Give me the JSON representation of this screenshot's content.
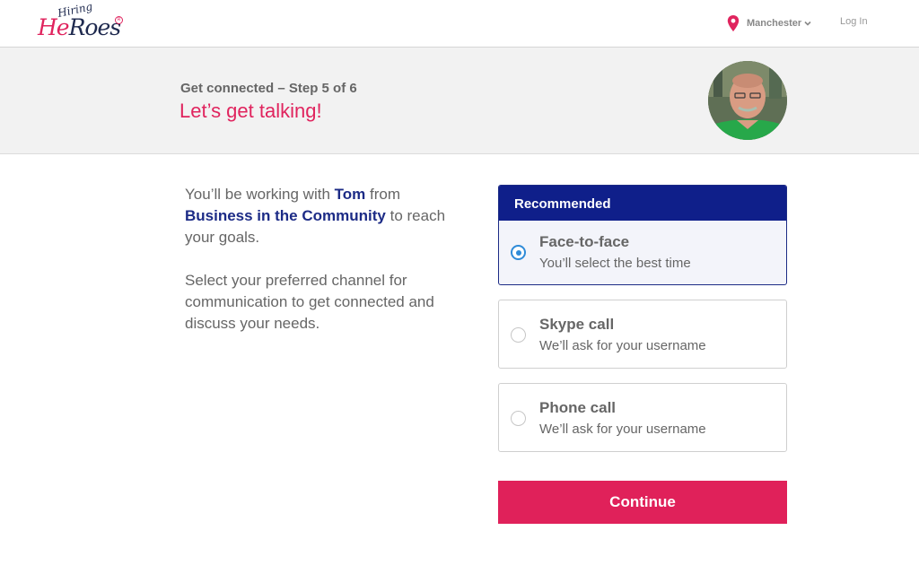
{
  "header": {
    "logo": {
      "small": "Hiring",
      "main_a": "He",
      "main_b": "Roes",
      "reg": "R"
    },
    "location": "Manchester",
    "login": "Log In"
  },
  "banner": {
    "step": "Get connected – Step 5 of 6",
    "title": "Let’s get talking!"
  },
  "intro": {
    "p1_a": "You’ll be working with ",
    "name": "Tom",
    "p1_b": " from ",
    "org": "Business in the Community",
    "p1_c": " to reach your goals.",
    "p2": "Select your preferred channel for communication to get connected and discuss your needs."
  },
  "options": {
    "recommended_label": "Recommended",
    "items": [
      {
        "title": "Face-to-face",
        "subtitle": "You’ll select the best time",
        "selected": true
      },
      {
        "title": "Skype call",
        "subtitle": "We’ll ask for your username",
        "selected": false
      },
      {
        "title": "Phone call",
        "subtitle": "We’ll ask for your username",
        "selected": false
      }
    ]
  },
  "continue_label": "Continue",
  "colors": {
    "accent": "#e0245e",
    "navy": "#1c2b86",
    "radio": "#2f8bd8"
  },
  "icons": [
    "location-pin-icon",
    "chevron-down-icon"
  ]
}
